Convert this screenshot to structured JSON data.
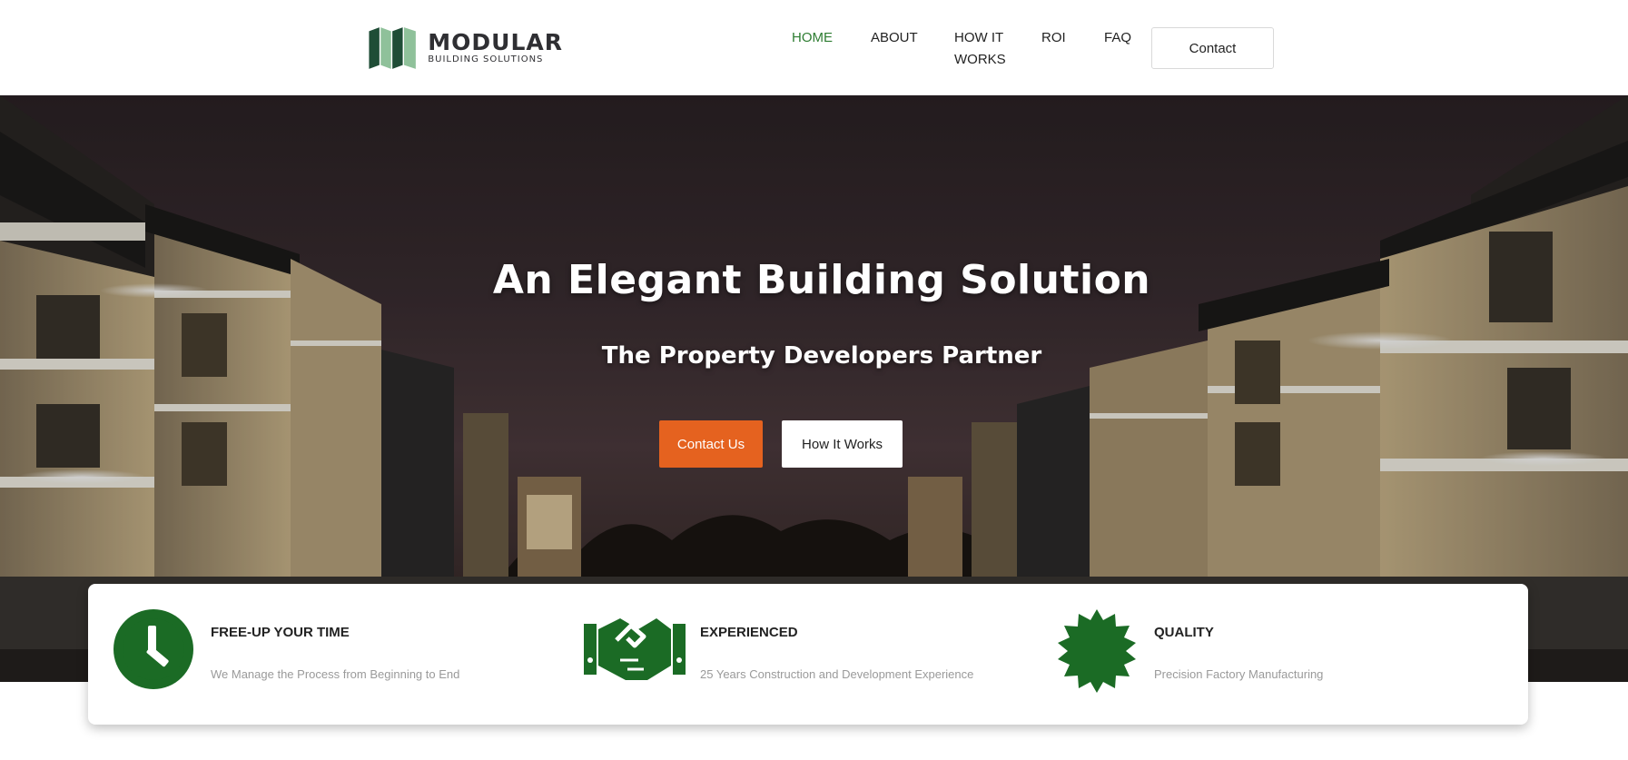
{
  "header": {
    "logo": {
      "title": "MODULAR",
      "subtitle": "BUILDING SOLUTIONS"
    },
    "nav": {
      "home": "HOME",
      "about": "ABOUT",
      "how_it_works": "HOW IT WORKS",
      "roi": "ROI",
      "faq": "FAQ",
      "contact": "Contact"
    },
    "active_color": "#2e7d32"
  },
  "hero": {
    "title": "An Elegant Building Solution",
    "subtitle": "The Property Developers Partner",
    "primary_button": "Contact Us",
    "secondary_button": "How It Works",
    "primary_color": "#e5621f"
  },
  "features": [
    {
      "icon": "clock-icon",
      "title": "FREE-UP YOUR TIME",
      "desc": "We Manage the Process from Beginning to End"
    },
    {
      "icon": "handshake-icon",
      "title": "EXPERIENCED",
      "desc": "25 Years Construction and Development Experience"
    },
    {
      "icon": "badge-icon",
      "title": "QUALITY",
      "desc": "Precision Factory Manufacturing"
    }
  ],
  "brand_green": "#1b6b25"
}
